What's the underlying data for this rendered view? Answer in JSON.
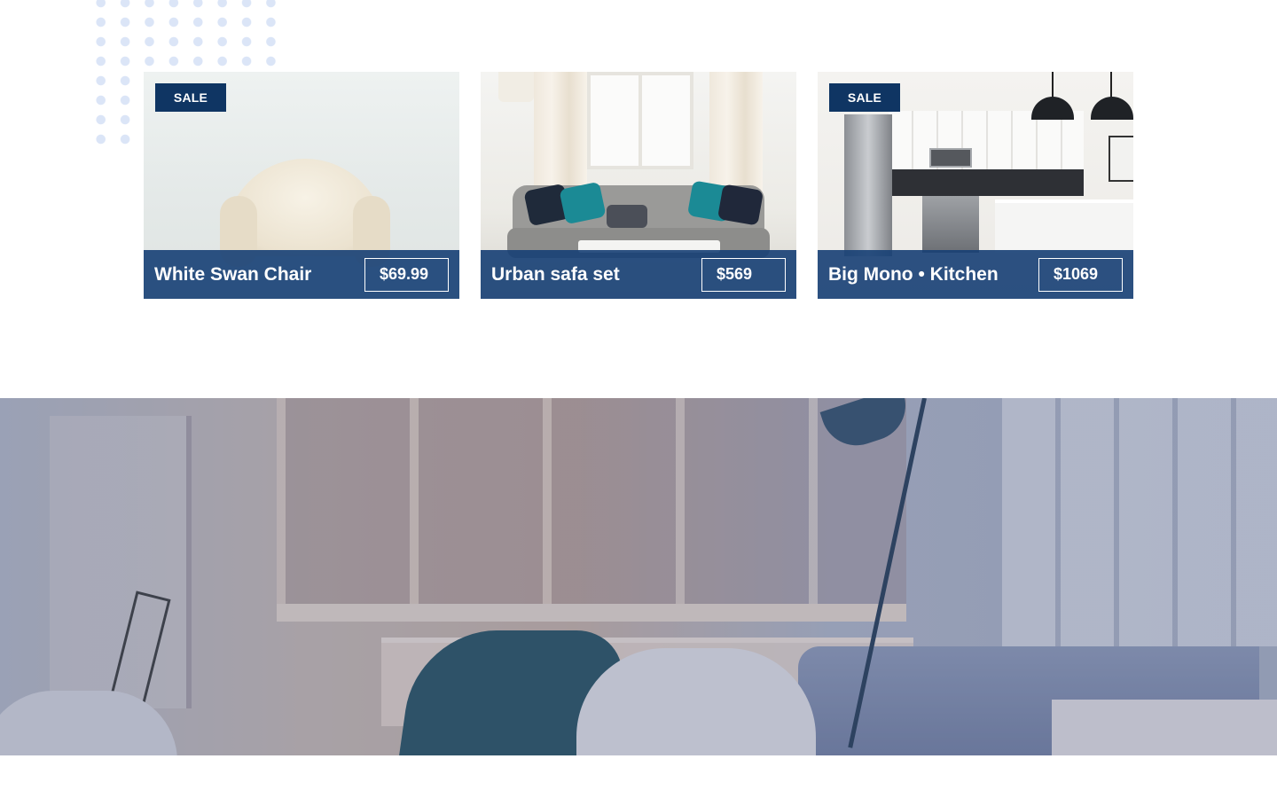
{
  "products": [
    {
      "title": "White Swan Chair",
      "price": "$69.99",
      "badge": "SALE",
      "on_sale": true
    },
    {
      "title": "Urban safa set",
      "price": "$569",
      "badge": "",
      "on_sale": false
    },
    {
      "title": "Big Mono • Kitchen",
      "price": "$1069",
      "badge": "SALE",
      "on_sale": true
    }
  ],
  "colors": {
    "accent": "#0f3563",
    "card_bar": "#163f74",
    "dots": "#dbe5f7"
  },
  "icons": []
}
